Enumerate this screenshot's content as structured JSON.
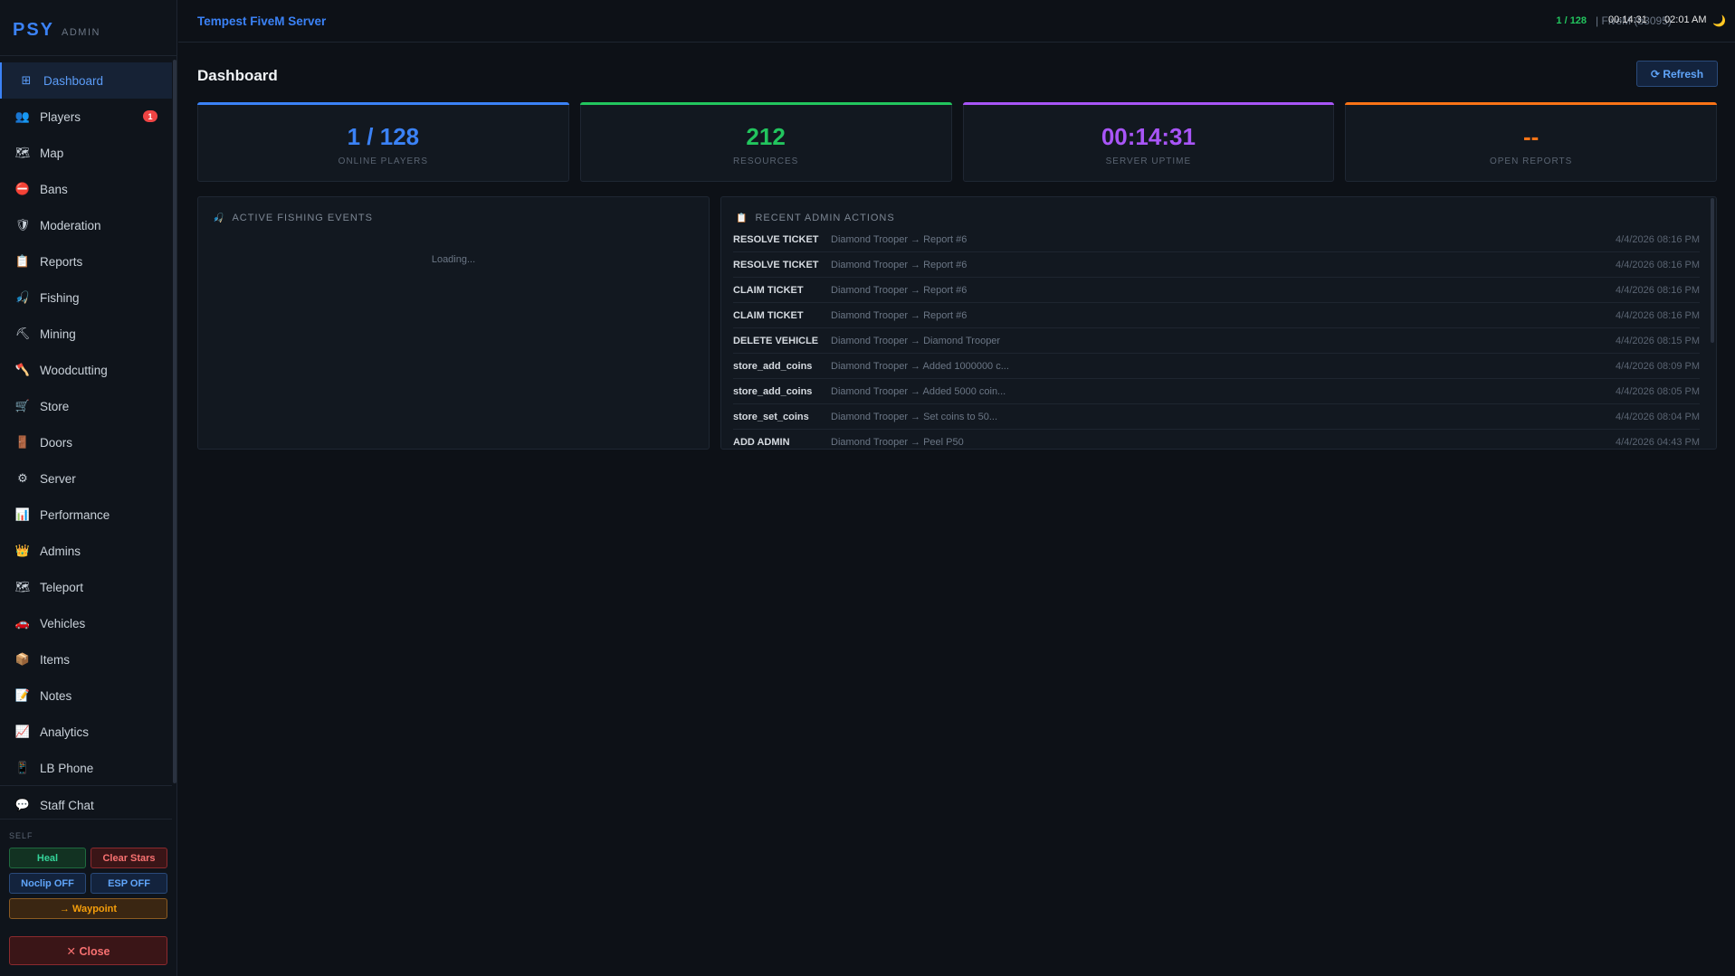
{
  "brand": {
    "logo": "PSY",
    "sub": "ADMIN"
  },
  "sidebar": {
    "items": [
      {
        "label": "Dashboard",
        "icon": "dashboard-icon",
        "glyph": "⊞",
        "active": true
      },
      {
        "label": "Players",
        "icon": "players-icon",
        "glyph": "👥",
        "badge": "1"
      },
      {
        "label": "Map",
        "icon": "map-icon",
        "glyph": "🗺"
      },
      {
        "label": "Bans",
        "icon": "ban-icon",
        "glyph": "⛔"
      },
      {
        "label": "Moderation",
        "icon": "shield-icon",
        "glyph": "🛡"
      },
      {
        "label": "Reports",
        "icon": "clipboard-icon",
        "glyph": "📋"
      },
      {
        "label": "Fishing",
        "icon": "fishing-icon",
        "glyph": "🎣"
      },
      {
        "label": "Mining",
        "icon": "pickaxe-icon",
        "glyph": "⛏"
      },
      {
        "label": "Woodcutting",
        "icon": "axe-icon",
        "glyph": "🪓"
      },
      {
        "label": "Store",
        "icon": "cart-icon",
        "glyph": "🛒"
      },
      {
        "label": "Doors",
        "icon": "door-icon",
        "glyph": "🚪"
      },
      {
        "label": "Server",
        "icon": "gear-icon",
        "glyph": "⚙"
      },
      {
        "label": "Performance",
        "icon": "chart-icon",
        "glyph": "📊"
      },
      {
        "label": "Admins",
        "icon": "crown-icon",
        "glyph": "👑"
      },
      {
        "label": "Teleport",
        "icon": "teleport-icon",
        "glyph": "🗺"
      },
      {
        "label": "Vehicles",
        "icon": "car-icon",
        "glyph": "🚗"
      },
      {
        "label": "Items",
        "icon": "box-icon",
        "glyph": "📦"
      },
      {
        "label": "Notes",
        "icon": "note-icon",
        "glyph": "📝"
      },
      {
        "label": "Analytics",
        "icon": "analytics-icon",
        "glyph": "📈"
      },
      {
        "label": "LB Phone",
        "icon": "phone-icon",
        "glyph": "📱"
      }
    ],
    "staff_chat": {
      "label": "Staff Chat",
      "icon": "chat-icon",
      "glyph": "💬"
    },
    "self_label": "SELF",
    "self_buttons": {
      "heal": "Heal",
      "clear_stars": "Clear Stars",
      "noclip": "Noclip OFF",
      "esp": "ESP OFF",
      "waypoint": "→ Waypoint"
    },
    "close_label": "✕ Close"
  },
  "topbar": {
    "server_name": "Tempest FiveM Server",
    "players": "1 / 128",
    "version": "| FiveM (b3095) ",
    "uptime": "00:14:31",
    "clock": "02:01 AM",
    "theme_glyph": "🌙"
  },
  "main": {
    "title": "Dashboard",
    "refresh_label": "⟳ Refresh",
    "stats": [
      {
        "value": "1 / 128",
        "label": "ONLINE PLAYERS",
        "accent": "#3b82f6"
      },
      {
        "value": "212",
        "label": "RESOURCES",
        "accent": "#22c55e"
      },
      {
        "value": "00:14:31",
        "label": "SERVER UPTIME",
        "accent": "#a855f7"
      },
      {
        "value": "--",
        "label": "OPEN REPORTS",
        "accent": "#f97316"
      }
    ],
    "fishing": {
      "title": "ACTIVE FISHING EVENTS",
      "loading": "Loading..."
    },
    "admin_actions": {
      "title": "RECENT ADMIN ACTIONS",
      "rows": [
        {
          "action": "RESOLVE TICKET",
          "detail": "Diamond Trooper → Report #6",
          "time": "4/4/2026 08:16 PM"
        },
        {
          "action": "RESOLVE TICKET",
          "detail": "Diamond Trooper → Report #6",
          "time": "4/4/2026 08:16 PM"
        },
        {
          "action": "CLAIM TICKET",
          "detail": "Diamond Trooper → Report #6",
          "time": "4/4/2026 08:16 PM"
        },
        {
          "action": "CLAIM TICKET",
          "detail": "Diamond Trooper → Report #6",
          "time": "4/4/2026 08:16 PM"
        },
        {
          "action": "DELETE VEHICLE",
          "detail": "Diamond Trooper → Diamond Trooper",
          "time": "4/4/2026 08:15 PM"
        },
        {
          "action": "store_add_coins",
          "detail": "Diamond Trooper → Added 1000000 c...",
          "time": "4/4/2026 08:09 PM"
        },
        {
          "action": "store_add_coins",
          "detail": "Diamond Trooper → Added 5000 coin...",
          "time": "4/4/2026 08:05 PM"
        },
        {
          "action": "store_set_coins",
          "detail": "Diamond Trooper → Set coins to 50...",
          "time": "4/4/2026 08:04 PM"
        },
        {
          "action": "ADD ADMIN",
          "detail": "Diamond Trooper → Peel P50",
          "time": "4/4/2026 04:43 PM"
        }
      ]
    }
  }
}
